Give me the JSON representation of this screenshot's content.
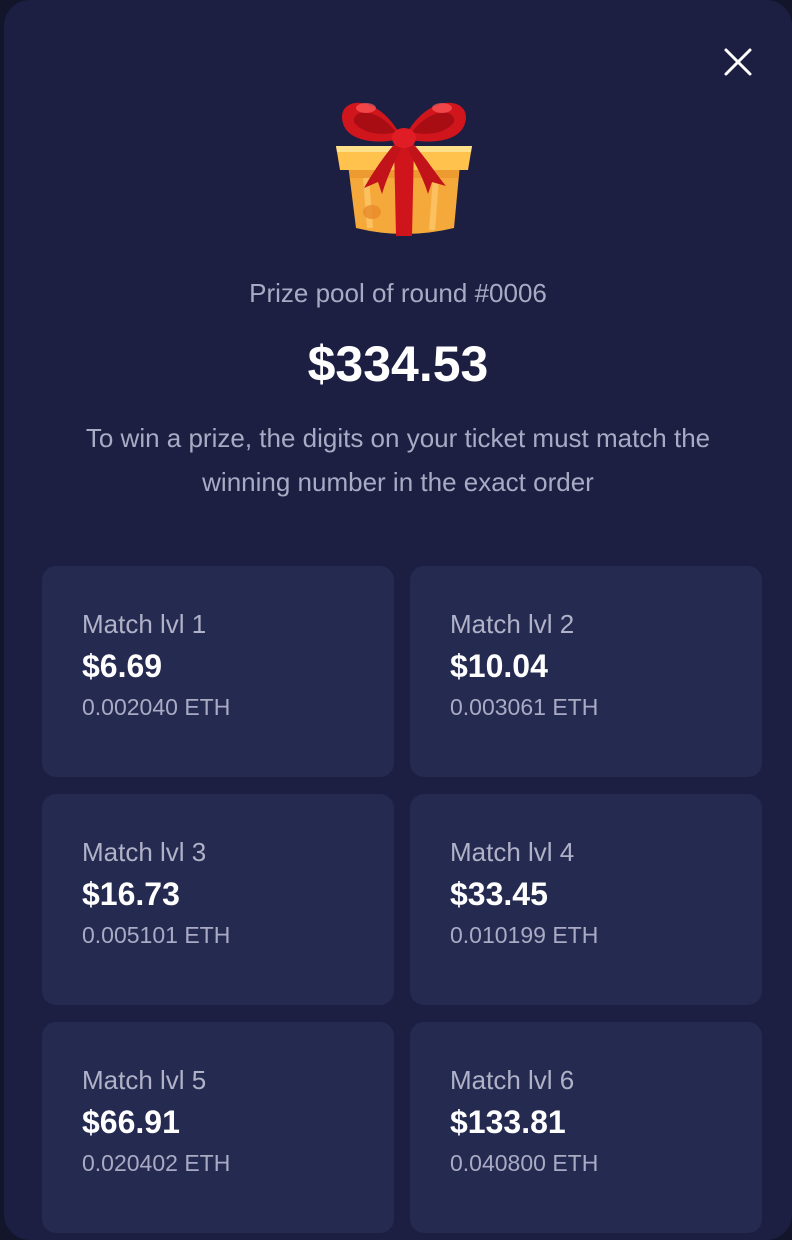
{
  "modal": {
    "close_icon": "close-icon",
    "gift_icon": "gift-box-icon",
    "subtitle": "Prize pool of round #0006",
    "amount": "$334.53",
    "description": "To win a prize, the digits on your ticket must match the winning number in the exact order"
  },
  "levels": [
    {
      "label": "Match lvl 1",
      "usd": "$6.69",
      "eth": "0.002040 ETH"
    },
    {
      "label": "Match lvl 2",
      "usd": "$10.04",
      "eth": "0.003061 ETH"
    },
    {
      "label": "Match lvl 3",
      "usd": "$16.73",
      "eth": "0.005101 ETH"
    },
    {
      "label": "Match lvl 4",
      "usd": "$33.45",
      "eth": "0.010199 ETH"
    },
    {
      "label": "Match lvl 5",
      "usd": "$66.91",
      "eth": "0.020402 ETH"
    },
    {
      "label": "Match lvl 6",
      "usd": "$133.81",
      "eth": "0.040800 ETH"
    }
  ],
  "colors": {
    "backdrop": "#13162b",
    "modal_bg": "#1c1f42",
    "card_bg": "#252a50",
    "text_primary": "#ffffff",
    "text_muted": "#a9abc4",
    "ribbon": "#d0151d",
    "box": "#f7b33a"
  }
}
